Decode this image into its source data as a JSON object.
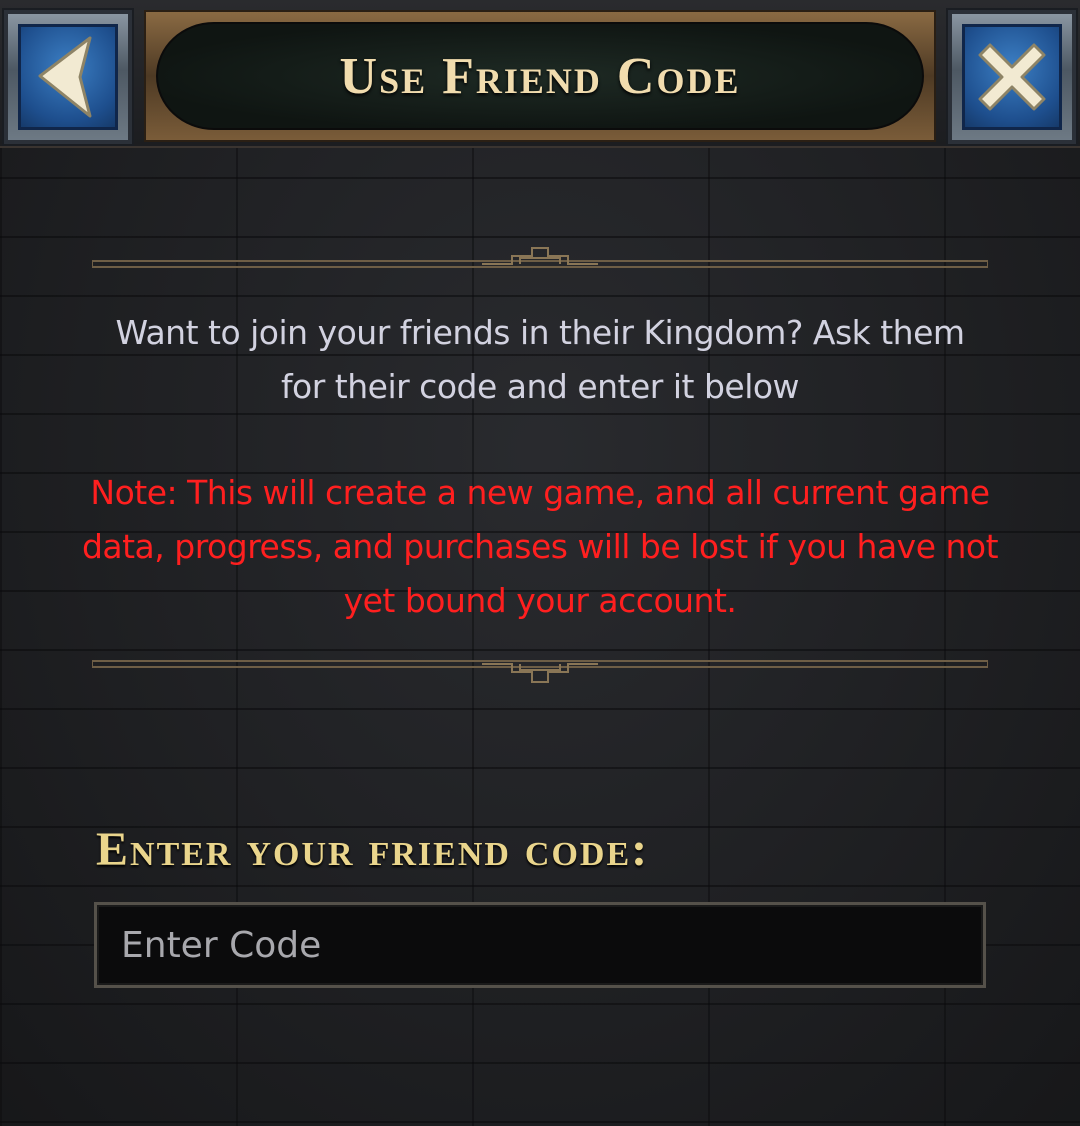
{
  "header": {
    "title": "Use Friend Code",
    "back_icon": "back-arrow-icon",
    "close_icon": "close-x-icon"
  },
  "body": {
    "description": "Want to join your friends in their Kingdom?  Ask them for their code and enter it below",
    "warning": "Note: This will create a new game, and all current game data, progress, and purchases will be lost if you have not yet bound your account."
  },
  "code_entry": {
    "label": "Enter your friend code:",
    "placeholder": "Enter Code",
    "value": ""
  },
  "colors": {
    "title": "#f1dcae",
    "description": "#d2d2e0",
    "warning": "#ff1f1f",
    "label": "#ead58c",
    "button_blue": "#2b63a8"
  }
}
